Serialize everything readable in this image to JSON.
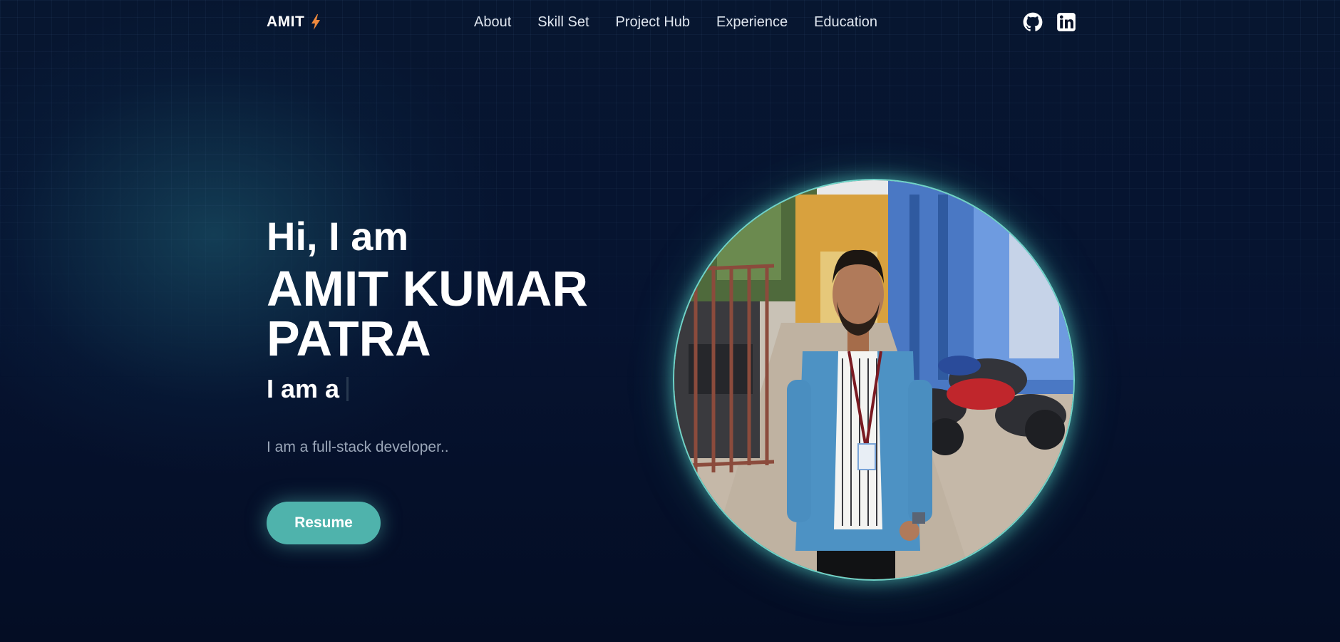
{
  "brand": {
    "name": "AMIT",
    "bolt_color": "#f08a3e"
  },
  "nav": {
    "items": [
      "About",
      "Skill Set",
      "Project Hub",
      "Experience",
      "Education"
    ]
  },
  "social": [
    {
      "icon": "github-icon"
    },
    {
      "icon": "linkedin-icon"
    }
  ],
  "hero": {
    "greeting": "Hi, I am",
    "name": "AMIT KUMAR PATRA",
    "role_prefix": "I am a",
    "description": "I am a full-stack developer..",
    "resume_label": "Resume"
  },
  "colors": {
    "background": "#050f26",
    "accent": "#4fb3ac",
    "photo_ring": "#6fd4c8"
  }
}
